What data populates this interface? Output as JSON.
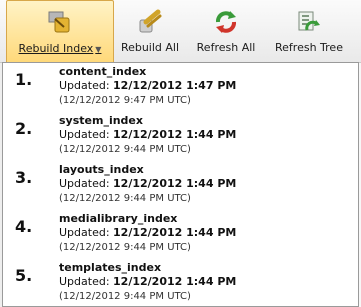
{
  "toolbar": {
    "buttons": [
      {
        "label": "Rebuild Index",
        "icon": "rebuild-index-icon"
      },
      {
        "label": "Rebuild All",
        "icon": "rebuild-all-icon"
      },
      {
        "label": "Refresh All",
        "icon": "refresh-all-icon"
      },
      {
        "label": "Refresh Tree",
        "icon": "refresh-tree-icon"
      }
    ]
  },
  "indexes": [
    {
      "num": "1.",
      "name": "content_index",
      "updated_label": "Updated:",
      "updated": "12/12/2012 1:47 PM",
      "utc": "(12/12/2012 9:47 PM UTC)"
    },
    {
      "num": "2.",
      "name": "system_index",
      "updated_label": "Updated:",
      "updated": "12/12/2012 1:44 PM",
      "utc": "(12/12/2012 9:44 PM UTC)"
    },
    {
      "num": "3.",
      "name": "layouts_index",
      "updated_label": "Updated:",
      "updated": "12/12/2012 1:44 PM",
      "utc": "(12/12/2012 9:44 PM UTC)"
    },
    {
      "num": "4.",
      "name": "medialibrary_index",
      "updated_label": "Updated:",
      "updated": "12/12/2012 1:44 PM",
      "utc": "(12/12/2012 9:44 PM UTC)"
    },
    {
      "num": "5.",
      "name": "templates_index",
      "updated_label": "Updated:",
      "updated": "12/12/2012 1:44 PM",
      "utc": "(12/12/2012 9:44 PM UTC)"
    }
  ]
}
